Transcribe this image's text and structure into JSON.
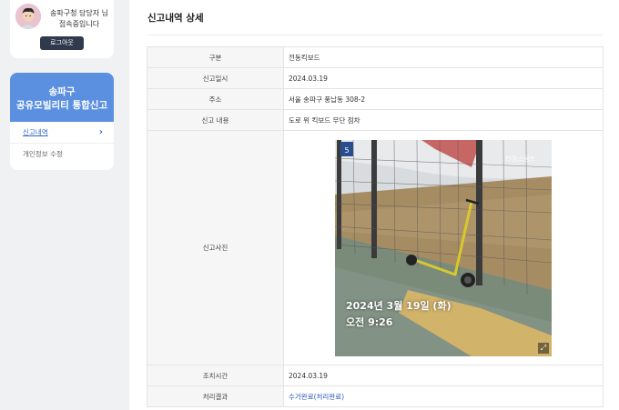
{
  "user": {
    "line1": "송파구청 담당자 님",
    "line2": "접속중입니다",
    "logout_label": "로그아웃"
  },
  "menu": {
    "title_line1": "송파구",
    "title_line2": "공유모빌리티 통합신고",
    "items": [
      {
        "label": "신고내역",
        "active": true
      },
      {
        "label": "개인정보 수정",
        "active": false
      }
    ]
  },
  "page": {
    "title": "신고내역 상세"
  },
  "detail": {
    "rows": [
      {
        "label": "구분",
        "value": "전동킥보드"
      },
      {
        "label": "신고일시",
        "value": "2024.03.19"
      },
      {
        "label": "주소",
        "value": "서울 송파구 풍납동 308-2"
      },
      {
        "label": "신고 내용",
        "value": "도로 위 킥보드 무단 점차"
      }
    ],
    "photo_label": "신고사진",
    "photo": {
      "stamp_line1": "2024년 3월 19일 (화)",
      "stamp_line2": "오전 9:26",
      "brand": "타임스탬프",
      "pole_sign": "5",
      "expand_icon": "expand-icon",
      "colors": {
        "scooter": "#d9c82c",
        "fence": "#3b3b3b",
        "paving": "#7a8b7a",
        "tactile": "#d2b36a"
      }
    },
    "action_time_label": "조치시간",
    "action_time_value": "2024.03.19",
    "result_label": "처리결과",
    "result_value": "수거완료(처리완료)"
  },
  "colors": {
    "accent": "#5b8fe0",
    "link": "#2a55b9",
    "logout_bg": "#2f3a4c",
    "background": "#f0f1f3"
  }
}
